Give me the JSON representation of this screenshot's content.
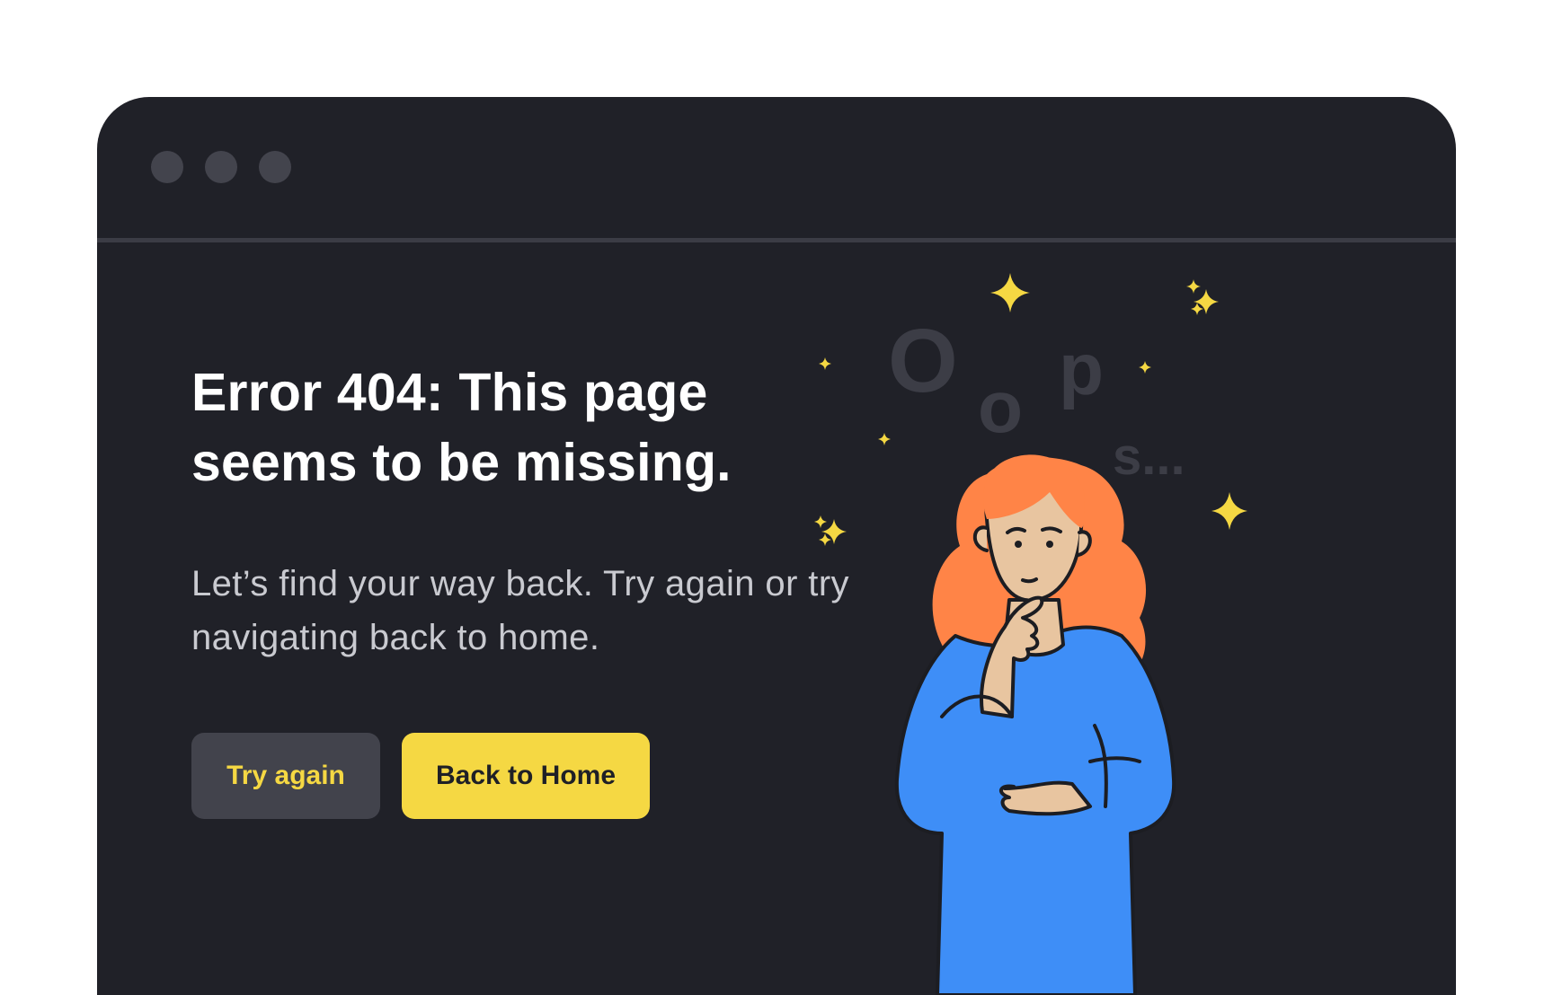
{
  "window": {
    "controls": [
      "close",
      "minimize",
      "maximize"
    ]
  },
  "error": {
    "headline": "Error 404: This page seems to be missing.",
    "message": "Let’s find your way back. Try again or try navigating back to home."
  },
  "actions": {
    "try_again_label": "Try again",
    "back_home_label": "Back to Home"
  },
  "illustration": {
    "letters": [
      "O",
      "o",
      "p",
      "s..."
    ],
    "icons": [
      "sparkle-icon",
      "person-thinking-illustration"
    ]
  },
  "colors": {
    "page_background": "#ffffff",
    "window_background": "#202128",
    "accent_yellow": "#f5d843",
    "secondary_button": "#42434c",
    "hair": "#ff8447",
    "shirt": "#3e8ef7",
    "skin": "#e8c5a0"
  }
}
